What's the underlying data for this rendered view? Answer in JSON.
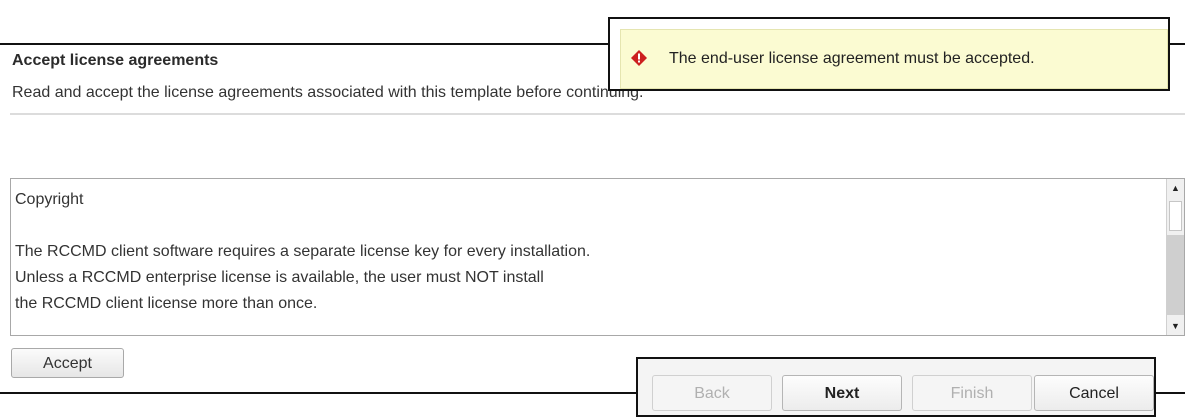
{
  "header": {
    "title": "Accept license agreements",
    "subtitle": "Read and accept the license agreements associated with this template before continuing."
  },
  "license": {
    "lines": [
      "Copyright",
      "",
      "The RCCMD client software requires a separate license key for every installation.",
      "Unless a RCCMD enterprise license is available, the user must NOT install",
      "the RCCMD client license more than once."
    ]
  },
  "accept_button": {
    "label": "Accept"
  },
  "error": {
    "message": "The end-user license agreement must be accepted.",
    "icon": "error-diamond-icon",
    "color": "#cc1f1f"
  },
  "nav": {
    "back_label": "Back",
    "next_label": "Next",
    "finish_label": "Finish",
    "cancel_label": "Cancel"
  }
}
